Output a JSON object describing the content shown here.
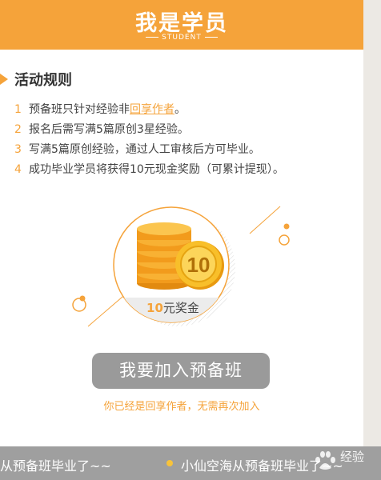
{
  "header": {
    "title": "我是学员",
    "subtitle": "STUDENT"
  },
  "rules": {
    "title": "活动规则",
    "items": [
      {
        "num": "1",
        "before": "预备班只针对经验非",
        "link": "回享作者",
        "after": "。"
      },
      {
        "num": "2",
        "text": "报名后需写满5篇原创3星经验。"
      },
      {
        "num": "3",
        "text": "写满5篇原创经验，通过人工审核后方可毕业。"
      },
      {
        "num": "4",
        "text": "成功毕业学员将获得10元现金奖励（可累计提现）。"
      }
    ]
  },
  "badge": {
    "coin_value": "10",
    "amount": "10",
    "unit_label": "元奖金"
  },
  "join_button": "我要加入预备班",
  "notice": "你已经是回享作者，无需再次加入",
  "ticker": {
    "left": "从预备班毕业了~~",
    "right": "小仙空海从预备班毕业了~~"
  },
  "watermark": {
    "text": "经验"
  },
  "colors": {
    "accent": "#f5a33a",
    "button": "#9a9a9a",
    "ticker_bg": "#9f9f9f"
  }
}
